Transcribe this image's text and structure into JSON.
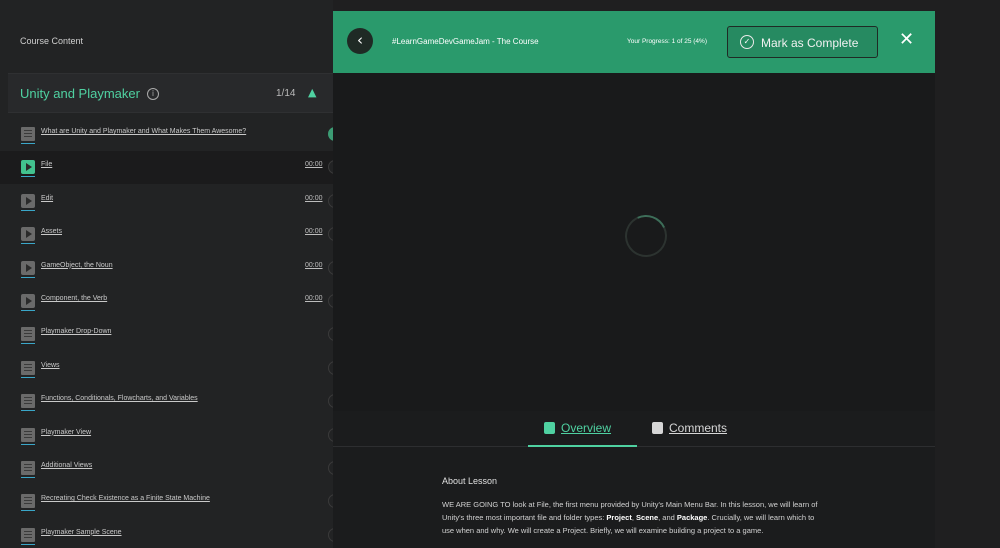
{
  "sidebar": {
    "heading": "Course Content",
    "section": {
      "title": "Unity and Playmaker",
      "count": "1/14"
    },
    "lessons": [
      {
        "title": "What are Unity and Playmaker and What Makes Them Awesome?",
        "type": "doc",
        "duration": "",
        "done": true
      },
      {
        "title": "File",
        "type": "video",
        "duration": "00:00",
        "active": true
      },
      {
        "title": "Edit",
        "type": "video",
        "duration": "00:00"
      },
      {
        "title": "Assets",
        "type": "video",
        "duration": "00:00"
      },
      {
        "title": "GameObject, the Noun",
        "type": "video",
        "duration": "00:00"
      },
      {
        "title": "Component, the Verb",
        "type": "video",
        "duration": "00:00"
      },
      {
        "title": "Playmaker Drop-Down",
        "type": "doc",
        "duration": ""
      },
      {
        "title": "Views",
        "type": "doc",
        "duration": ""
      },
      {
        "title": "Functions, Conditionals, Flowcharts, and Variables",
        "type": "doc",
        "duration": ""
      },
      {
        "title": "Playmaker View",
        "type": "doc",
        "duration": ""
      },
      {
        "title": "Additional Views",
        "type": "doc",
        "duration": ""
      },
      {
        "title": "Recreating Check Existence as a Finite State Machine",
        "type": "doc",
        "duration": ""
      },
      {
        "title": "Playmaker Sample Scene",
        "type": "doc",
        "duration": ""
      }
    ]
  },
  "header": {
    "course_title": "#LearnGameDevGameJam - The Course",
    "progress_label": "Your Progress:",
    "progress_value": "1 of 25 (4%)",
    "progress_fraction": 0.04,
    "mark_complete": "Mark as Complete"
  },
  "tabs": {
    "overview": "Overview",
    "comments": "Comments"
  },
  "about": {
    "title": "About Lesson",
    "line1": "WE ARE GOING TO look at File, the first menu provided by Unity's Main Menu Bar. In this lesson, we will learn of",
    "line2a": "Unity's three most important file and folder types: ",
    "project": "Project",
    "scene": "Scene",
    "package": "Package",
    "line2b": ". Crucially, we will learn which to",
    "line3": "use when and why. We will create a Project. Briefly, we will examine building a project to a game."
  },
  "colors": {
    "accent": "#4fd1a1",
    "header_bg": "#2a9a6c",
    "background": "#1f1f20"
  }
}
